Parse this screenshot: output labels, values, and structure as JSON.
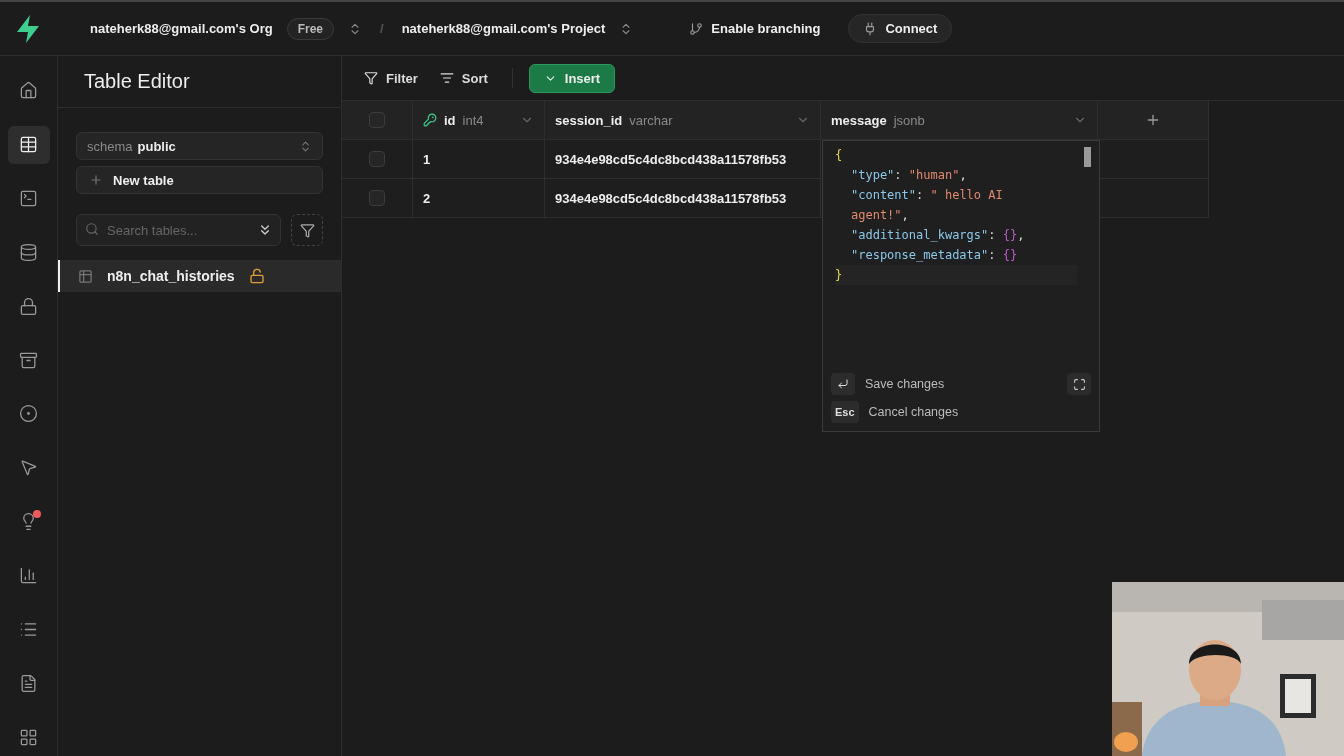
{
  "topbar": {
    "org": "nateherk88@gmail.com's Org",
    "plan": "Free",
    "separator": "/",
    "project": "nateherk88@gmail.com's Project",
    "branching": "Enable branching",
    "connect": "Connect"
  },
  "rail": [
    {
      "selected": false,
      "notification": false
    },
    {
      "selected": true,
      "notification": false
    },
    {
      "selected": false,
      "notification": false
    },
    {
      "selected": false,
      "notification": false
    },
    {
      "selected": false,
      "notification": false
    },
    {
      "selected": false,
      "notification": false
    },
    {
      "selected": false,
      "notification": false
    },
    {
      "selected": false,
      "notification": false
    },
    {
      "selected": false,
      "notification": true
    },
    {
      "selected": false,
      "notification": false
    },
    {
      "selected": false,
      "notification": false
    },
    {
      "selected": false,
      "notification": false
    },
    {
      "selected": false,
      "notification": false
    }
  ],
  "sidebar": {
    "title": "Table Editor",
    "schema_label": "schema",
    "schema_value": "public",
    "new_table": "New table",
    "search_placeholder": "Search tables...",
    "tables": [
      {
        "name": "n8n_chat_histories",
        "selected": true,
        "locked": false
      }
    ]
  },
  "toolbar": {
    "filter": "Filter",
    "sort": "Sort",
    "insert": "Insert"
  },
  "table": {
    "select_all_checked": false,
    "columns": [
      {
        "name": "id",
        "type": "int4",
        "primary_key": true
      },
      {
        "name": "session_id",
        "type": "varchar",
        "primary_key": false
      },
      {
        "name": "message",
        "type": "jsonb",
        "primary_key": false
      }
    ],
    "rows": [
      {
        "checked": false,
        "cells": [
          "1",
          "934e4e98cd5c4dc8bcd438a11578fb53"
        ]
      },
      {
        "checked": false,
        "cells": [
          "2",
          "934e4e98cd5c4dc8bcd438a11578fb53"
        ]
      }
    ]
  },
  "editor": {
    "lines": [
      [
        {
          "text": "{",
          "kind": "brace"
        }
      ],
      [
        {
          "text": "\"type\"",
          "kind": "key"
        },
        {
          "text": ": ",
          "kind": "punct"
        },
        {
          "text": "\"human\"",
          "kind": "string"
        },
        {
          "text": ",",
          "kind": "punct"
        }
      ],
      [
        {
          "text": "\"content\"",
          "kind": "key"
        },
        {
          "text": ": ",
          "kind": "punct"
        },
        {
          "text": "\" hello AI",
          "kind": "string"
        }
      ],
      [
        {
          "text": "agent!\"",
          "kind": "string"
        },
        {
          "text": ",",
          "kind": "punct"
        }
      ],
      [
        {
          "text": "\"additional_kwargs\"",
          "kind": "key"
        },
        {
          "text": ": ",
          "kind": "punct"
        },
        {
          "text": "{}",
          "kind": "object"
        },
        {
          "text": ",",
          "kind": "punct"
        }
      ],
      [
        {
          "text": "\"response_metadata\"",
          "kind": "key"
        },
        {
          "text": ": ",
          "kind": "punct"
        },
        {
          "text": "{}",
          "kind": "object"
        }
      ],
      [
        {
          "text": "}",
          "kind": "brace"
        }
      ]
    ],
    "save": "Save changes",
    "cancel_key": "Esc",
    "cancel": "Cancel changes"
  }
}
